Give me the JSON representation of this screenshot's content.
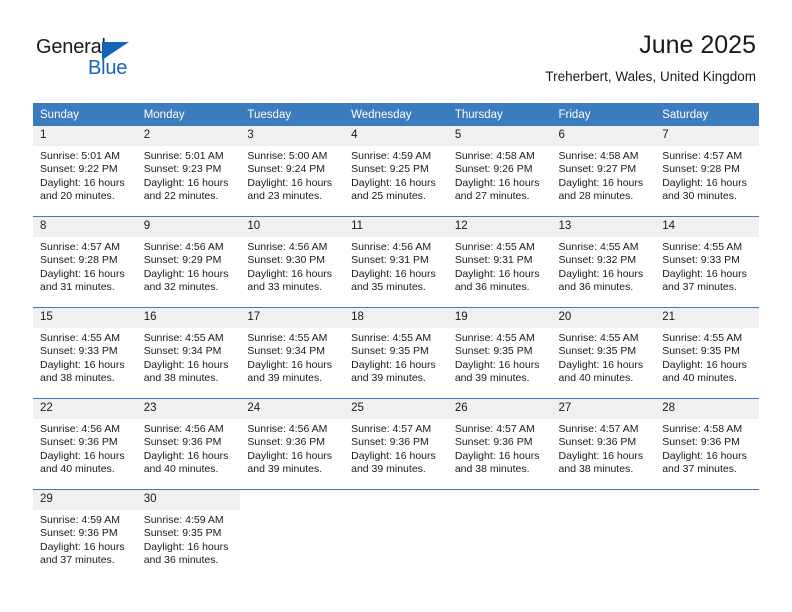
{
  "logo": {
    "word_one": "General",
    "word_two": "Blue",
    "triangle_color": "#1565b5",
    "text_color": "#1a1a1a"
  },
  "header": {
    "title": "June 2025",
    "subtitle": "Treherbert, Wales, United Kingdom"
  },
  "theme": {
    "header_bar": "#3b7cbf",
    "daynum_band": "#f0f0f0",
    "grid_line": "#3b7cbf",
    "text": "#1a1a1a",
    "page_bg": "#ffffff"
  },
  "weekday_headers": [
    "Sunday",
    "Monday",
    "Tuesday",
    "Wednesday",
    "Thursday",
    "Friday",
    "Saturday"
  ],
  "labels": {
    "sunrise_prefix": "Sunrise:",
    "sunset_prefix": "Sunset:",
    "daylight_prefix": "Daylight:"
  },
  "weeks": [
    [
      {
        "day": "1",
        "sunrise": "Sunrise: 5:01 AM",
        "sunset": "Sunset: 9:22 PM",
        "daylight_line1": "Daylight: 16 hours",
        "daylight_line2": "and 20 minutes."
      },
      {
        "day": "2",
        "sunrise": "Sunrise: 5:01 AM",
        "sunset": "Sunset: 9:23 PM",
        "daylight_line1": "Daylight: 16 hours",
        "daylight_line2": "and 22 minutes."
      },
      {
        "day": "3",
        "sunrise": "Sunrise: 5:00 AM",
        "sunset": "Sunset: 9:24 PM",
        "daylight_line1": "Daylight: 16 hours",
        "daylight_line2": "and 23 minutes."
      },
      {
        "day": "4",
        "sunrise": "Sunrise: 4:59 AM",
        "sunset": "Sunset: 9:25 PM",
        "daylight_line1": "Daylight: 16 hours",
        "daylight_line2": "and 25 minutes."
      },
      {
        "day": "5",
        "sunrise": "Sunrise: 4:58 AM",
        "sunset": "Sunset: 9:26 PM",
        "daylight_line1": "Daylight: 16 hours",
        "daylight_line2": "and 27 minutes."
      },
      {
        "day": "6",
        "sunrise": "Sunrise: 4:58 AM",
        "sunset": "Sunset: 9:27 PM",
        "daylight_line1": "Daylight: 16 hours",
        "daylight_line2": "and 28 minutes."
      },
      {
        "day": "7",
        "sunrise": "Sunrise: 4:57 AM",
        "sunset": "Sunset: 9:28 PM",
        "daylight_line1": "Daylight: 16 hours",
        "daylight_line2": "and 30 minutes."
      }
    ],
    [
      {
        "day": "8",
        "sunrise": "Sunrise: 4:57 AM",
        "sunset": "Sunset: 9:28 PM",
        "daylight_line1": "Daylight: 16 hours",
        "daylight_line2": "and 31 minutes."
      },
      {
        "day": "9",
        "sunrise": "Sunrise: 4:56 AM",
        "sunset": "Sunset: 9:29 PM",
        "daylight_line1": "Daylight: 16 hours",
        "daylight_line2": "and 32 minutes."
      },
      {
        "day": "10",
        "sunrise": "Sunrise: 4:56 AM",
        "sunset": "Sunset: 9:30 PM",
        "daylight_line1": "Daylight: 16 hours",
        "daylight_line2": "and 33 minutes."
      },
      {
        "day": "11",
        "sunrise": "Sunrise: 4:56 AM",
        "sunset": "Sunset: 9:31 PM",
        "daylight_line1": "Daylight: 16 hours",
        "daylight_line2": "and 35 minutes."
      },
      {
        "day": "12",
        "sunrise": "Sunrise: 4:55 AM",
        "sunset": "Sunset: 9:31 PM",
        "daylight_line1": "Daylight: 16 hours",
        "daylight_line2": "and 36 minutes."
      },
      {
        "day": "13",
        "sunrise": "Sunrise: 4:55 AM",
        "sunset": "Sunset: 9:32 PM",
        "daylight_line1": "Daylight: 16 hours",
        "daylight_line2": "and 36 minutes."
      },
      {
        "day": "14",
        "sunrise": "Sunrise: 4:55 AM",
        "sunset": "Sunset: 9:33 PM",
        "daylight_line1": "Daylight: 16 hours",
        "daylight_line2": "and 37 minutes."
      }
    ],
    [
      {
        "day": "15",
        "sunrise": "Sunrise: 4:55 AM",
        "sunset": "Sunset: 9:33 PM",
        "daylight_line1": "Daylight: 16 hours",
        "daylight_line2": "and 38 minutes."
      },
      {
        "day": "16",
        "sunrise": "Sunrise: 4:55 AM",
        "sunset": "Sunset: 9:34 PM",
        "daylight_line1": "Daylight: 16 hours",
        "daylight_line2": "and 38 minutes."
      },
      {
        "day": "17",
        "sunrise": "Sunrise: 4:55 AM",
        "sunset": "Sunset: 9:34 PM",
        "daylight_line1": "Daylight: 16 hours",
        "daylight_line2": "and 39 minutes."
      },
      {
        "day": "18",
        "sunrise": "Sunrise: 4:55 AM",
        "sunset": "Sunset: 9:35 PM",
        "daylight_line1": "Daylight: 16 hours",
        "daylight_line2": "and 39 minutes."
      },
      {
        "day": "19",
        "sunrise": "Sunrise: 4:55 AM",
        "sunset": "Sunset: 9:35 PM",
        "daylight_line1": "Daylight: 16 hours",
        "daylight_line2": "and 39 minutes."
      },
      {
        "day": "20",
        "sunrise": "Sunrise: 4:55 AM",
        "sunset": "Sunset: 9:35 PM",
        "daylight_line1": "Daylight: 16 hours",
        "daylight_line2": "and 40 minutes."
      },
      {
        "day": "21",
        "sunrise": "Sunrise: 4:55 AM",
        "sunset": "Sunset: 9:35 PM",
        "daylight_line1": "Daylight: 16 hours",
        "daylight_line2": "and 40 minutes."
      }
    ],
    [
      {
        "day": "22",
        "sunrise": "Sunrise: 4:56 AM",
        "sunset": "Sunset: 9:36 PM",
        "daylight_line1": "Daylight: 16 hours",
        "daylight_line2": "and 40 minutes."
      },
      {
        "day": "23",
        "sunrise": "Sunrise: 4:56 AM",
        "sunset": "Sunset: 9:36 PM",
        "daylight_line1": "Daylight: 16 hours",
        "daylight_line2": "and 40 minutes."
      },
      {
        "day": "24",
        "sunrise": "Sunrise: 4:56 AM",
        "sunset": "Sunset: 9:36 PM",
        "daylight_line1": "Daylight: 16 hours",
        "daylight_line2": "and 39 minutes."
      },
      {
        "day": "25",
        "sunrise": "Sunrise: 4:57 AM",
        "sunset": "Sunset: 9:36 PM",
        "daylight_line1": "Daylight: 16 hours",
        "daylight_line2": "and 39 minutes."
      },
      {
        "day": "26",
        "sunrise": "Sunrise: 4:57 AM",
        "sunset": "Sunset: 9:36 PM",
        "daylight_line1": "Daylight: 16 hours",
        "daylight_line2": "and 38 minutes."
      },
      {
        "day": "27",
        "sunrise": "Sunrise: 4:57 AM",
        "sunset": "Sunset: 9:36 PM",
        "daylight_line1": "Daylight: 16 hours",
        "daylight_line2": "and 38 minutes."
      },
      {
        "day": "28",
        "sunrise": "Sunrise: 4:58 AM",
        "sunset": "Sunset: 9:36 PM",
        "daylight_line1": "Daylight: 16 hours",
        "daylight_line2": "and 37 minutes."
      }
    ],
    [
      {
        "day": "29",
        "sunrise": "Sunrise: 4:59 AM",
        "sunset": "Sunset: 9:36 PM",
        "daylight_line1": "Daylight: 16 hours",
        "daylight_line2": "and 37 minutes."
      },
      {
        "day": "30",
        "sunrise": "Sunrise: 4:59 AM",
        "sunset": "Sunset: 9:35 PM",
        "daylight_line1": "Daylight: 16 hours",
        "daylight_line2": "and 36 minutes."
      },
      {
        "day": "",
        "sunrise": "",
        "sunset": "",
        "daylight_line1": "",
        "daylight_line2": ""
      },
      {
        "day": "",
        "sunrise": "",
        "sunset": "",
        "daylight_line1": "",
        "daylight_line2": ""
      },
      {
        "day": "",
        "sunrise": "",
        "sunset": "",
        "daylight_line1": "",
        "daylight_line2": ""
      },
      {
        "day": "",
        "sunrise": "",
        "sunset": "",
        "daylight_line1": "",
        "daylight_line2": ""
      },
      {
        "day": "",
        "sunrise": "",
        "sunset": "",
        "daylight_line1": "",
        "daylight_line2": ""
      }
    ]
  ]
}
